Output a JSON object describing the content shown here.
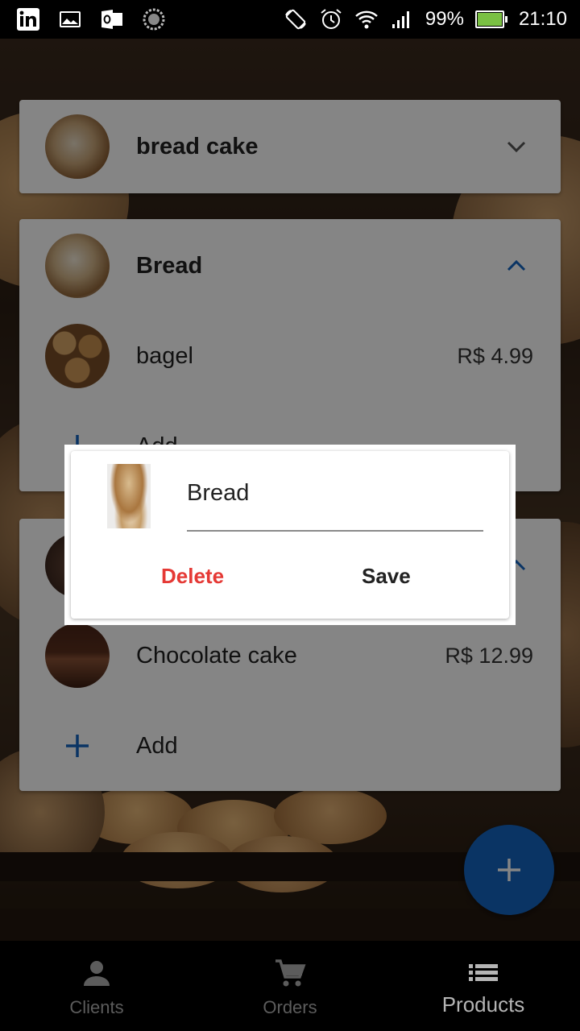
{
  "status_bar": {
    "left_icons": [
      "linkedin-icon",
      "image-icon",
      "outlook-icon",
      "sync-icon"
    ],
    "right_icons": [
      "rotate-icon",
      "alarm-icon",
      "wifi-icon",
      "signal-icon"
    ],
    "battery_percent": "99%",
    "battery_level": 0.99,
    "time": "21:10"
  },
  "categories": [
    {
      "name": "bread cake",
      "expanded": false,
      "icon": "chevron-down-icon"
    },
    {
      "name": "Bread",
      "expanded": true,
      "icon": "chevron-up-icon",
      "products": [
        {
          "name": "bagel",
          "price": "R$ 4.99"
        }
      ],
      "add_label": "Add"
    },
    {
      "name": "",
      "expanded": true,
      "icon": "chevron-up-icon",
      "products": [
        {
          "name": "Chocolate cake",
          "price": "R$ 12.99"
        }
      ],
      "add_label": "Add"
    }
  ],
  "dialog": {
    "input_value": "Bread",
    "delete_label": "Delete",
    "save_label": "Save"
  },
  "fab": {
    "icon": "plus-icon"
  },
  "bottom_nav": [
    {
      "label": "Clients",
      "icon": "person-icon",
      "active": false
    },
    {
      "label": "Orders",
      "icon": "cart-icon",
      "active": false
    },
    {
      "label": "Products",
      "icon": "list-icon",
      "active": true
    }
  ],
  "colors": {
    "accent": "#1565c0",
    "delete": "#e53935",
    "status_bar": "#000000",
    "battery_fill": "#7ac043"
  }
}
